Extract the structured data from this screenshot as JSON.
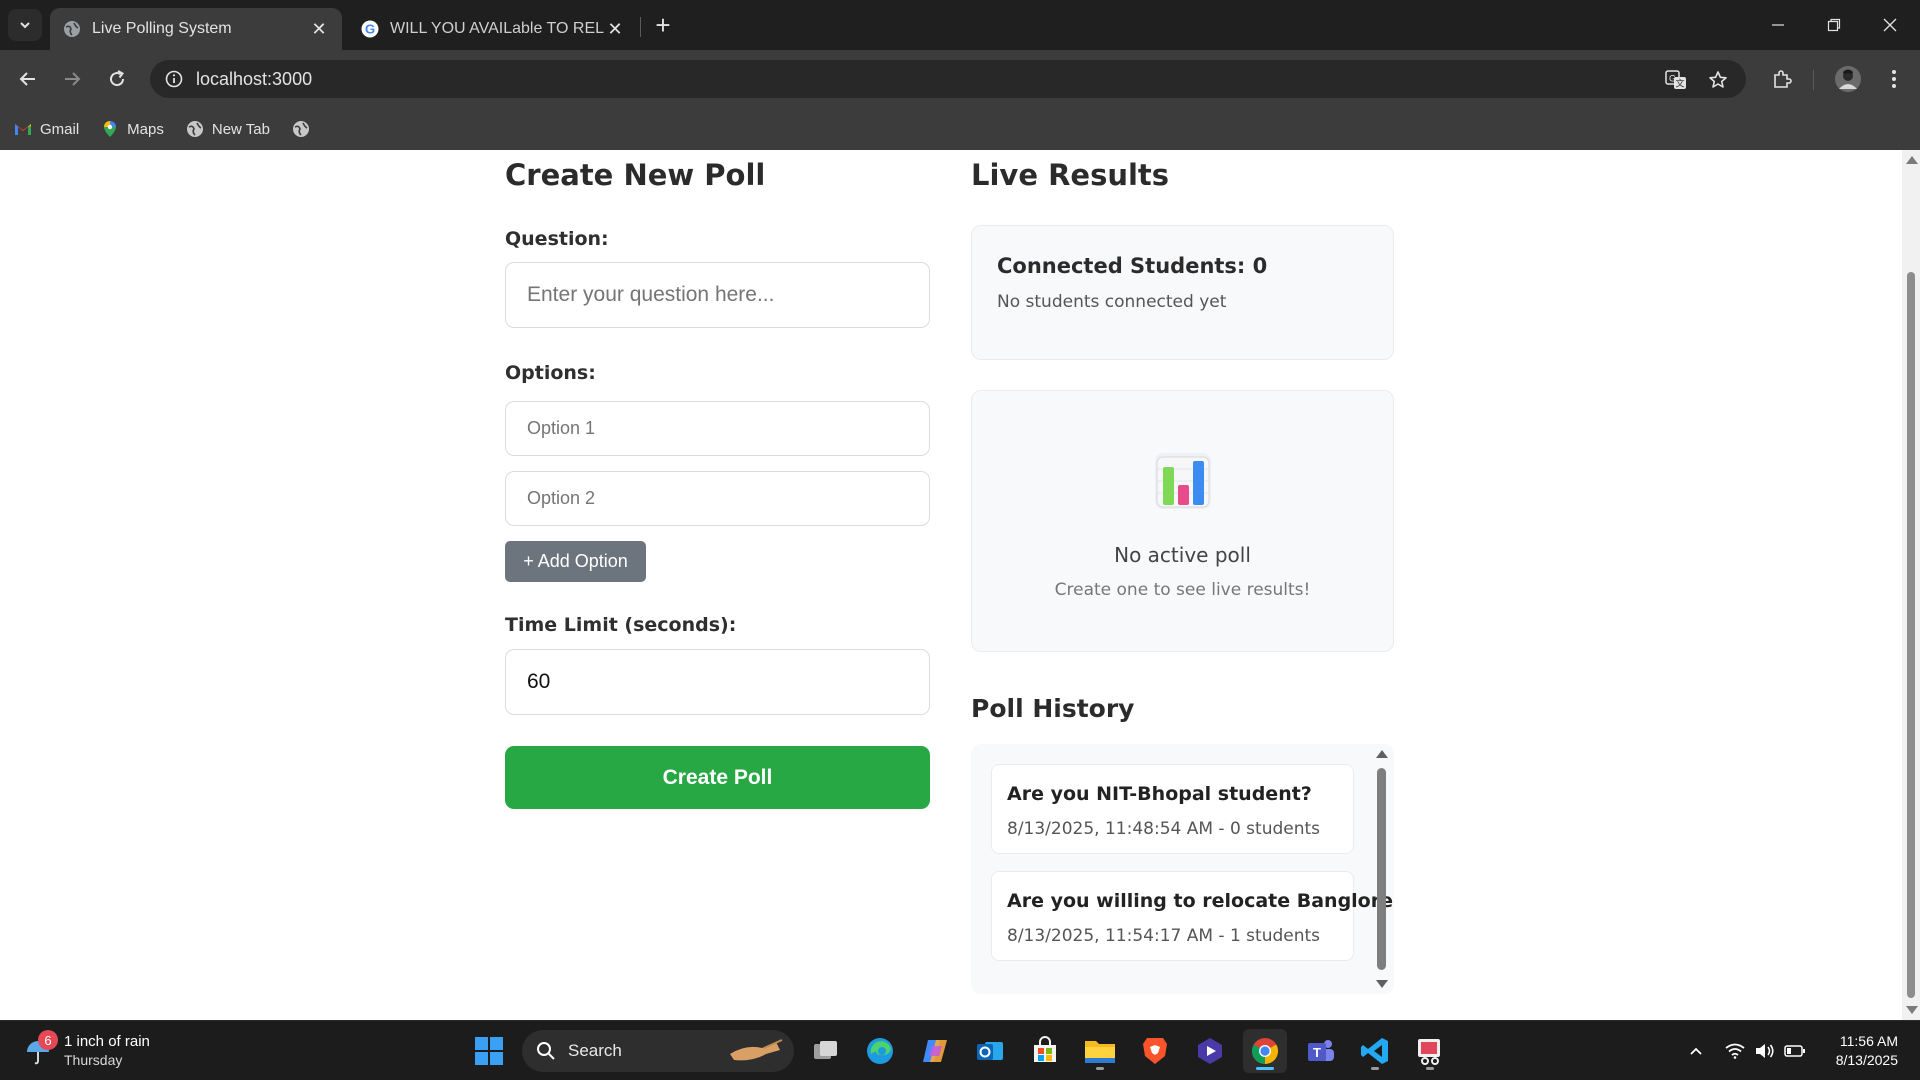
{
  "browser": {
    "tabs": [
      {
        "title": "Live Polling System",
        "active": true,
        "icon": "globe-icon"
      },
      {
        "title": "WILL YOU AVAILable TO RELOC",
        "active": false,
        "icon": "google-icon"
      }
    ],
    "url": "localhost:3000",
    "bookmarks": [
      {
        "label": "Gmail",
        "icon": "gmail-icon"
      },
      {
        "label": "Maps",
        "icon": "maps-icon"
      },
      {
        "label": "New Tab",
        "icon": "globe-icon"
      },
      {
        "label": "",
        "icon": "globe-icon"
      }
    ]
  },
  "create_poll": {
    "heading": "Create New Poll",
    "question_label": "Question:",
    "question_placeholder": "Enter your question here...",
    "options_label": "Options:",
    "option_placeholders": [
      "Option 1",
      "Option 2"
    ],
    "add_option_label": "+ Add Option",
    "time_limit_label": "Time Limit (seconds):",
    "time_limit_value": "60",
    "create_button_label": "Create Poll"
  },
  "live_results": {
    "heading": "Live Results",
    "connected_title": "Connected Students: 0",
    "connected_sub": "No students connected yet",
    "no_poll_title": "No active poll",
    "no_poll_sub": "Create one to see live results!",
    "chart_icon": "bar-chart-icon"
  },
  "history": {
    "heading": "Poll History",
    "items": [
      {
        "question": "Are you NIT-Bhopal student?",
        "meta": "8/13/2025, 11:48:54 AM - 0 students"
      },
      {
        "question": "Are you willing to relocate Banglore?",
        "meta": "8/13/2025, 11:54:17 AM - 1 students"
      }
    ]
  },
  "taskbar": {
    "weather_badge": "6",
    "weather_line1": "1 inch of rain",
    "weather_line2": "Thursday",
    "search_label": "Search",
    "time": "11:56 AM",
    "date": "8/13/2025"
  },
  "colors": {
    "create_button": "#28a745",
    "add_option_button": "#6c757d",
    "card_background": "#f8f9fa",
    "chrome_dark": "#1f1f1f",
    "chrome_toolbar": "#3c3c3c"
  }
}
